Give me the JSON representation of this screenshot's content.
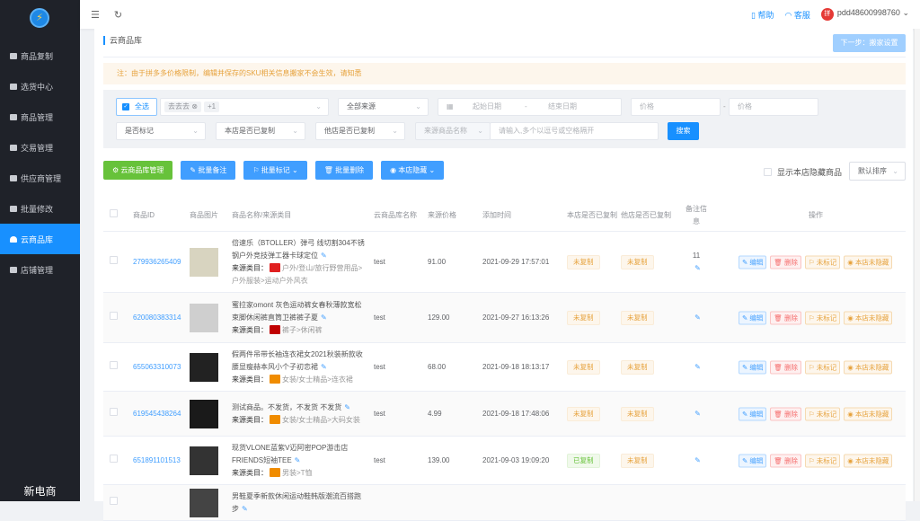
{
  "sidebar": {
    "brand": "新电商",
    "items": [
      {
        "label": "商品复制"
      },
      {
        "label": "选货中心"
      },
      {
        "label": "商品管理"
      },
      {
        "label": "交易管理"
      },
      {
        "label": "供应商管理"
      },
      {
        "label": "批量修改"
      },
      {
        "label": "云商品库",
        "active": true
      },
      {
        "label": "店铺管理"
      }
    ]
  },
  "topbar": {
    "help": "帮助",
    "service": "客服",
    "username": "pdd48600998760"
  },
  "page": {
    "title": "云商品库",
    "next_button": "下一步：搬家设置",
    "notice": "注：由于拼多多价格限制，编辑并保存的SKU相关信息搬家不会生效，请知悉"
  },
  "filters": {
    "select_all": "全选",
    "store_tag": "去去去",
    "more_count": "+1",
    "source": "全部来源",
    "start_date": "起始日期",
    "date_sep": "-",
    "end_date": "结束日期",
    "price_min": "价格",
    "price_sep": "-",
    "price_max": "价格",
    "marked": "是否标记",
    "own_copied": "本店是否已复制",
    "other_copied": "他店是否已复制",
    "name_field": "来源商品名称",
    "keyword_placeholder": "请输入,多个以逗号或空格隔开",
    "search": "搜索"
  },
  "actions": {
    "manage": "云商品库管理",
    "batch_note": "批量备注",
    "batch_mark": "批量标记",
    "batch_delete": "批量删除",
    "hide": "本店隐藏",
    "show_hidden": "显示本店隐藏商品",
    "sort": "默认排序"
  },
  "table": {
    "headers": {
      "id": "商品ID",
      "image": "商品图片",
      "name": "商品名称/来源类目",
      "cloud": "云商品库名称",
      "price": "来源价格",
      "time": "添加时间",
      "own": "本店是否已复制",
      "other": "他店是否已复制",
      "note": "备注信息",
      "ops": "操作"
    },
    "source_label": "来源类目：",
    "op_labels": {
      "edit": "编辑",
      "delete": "删除",
      "mark": "未标记",
      "hide": "本店未隐藏"
    },
    "rows": [
      {
        "id": "279936265409",
        "name": "倍速乐（BTOLLER）弹弓 线切割304不锈钢户外竞技弹工器卡球定位",
        "source": "户外/登山/旅行野营用品>户外服装>运动户外风衣",
        "cloud": "test",
        "price": "91.00",
        "time": "2021-09-29 17:57:01",
        "own": "未复制",
        "other": "未复制",
        "note": "11",
        "badge_color": "#e02020",
        "img_color": "#d8d4c0"
      },
      {
        "id": "620080383314",
        "name": "蜜拉家omont 灰色运动裤女春秋薄款宽松束脚休闲裤直筒卫裤裤子夏",
        "source": "裤子>休闲裤",
        "cloud": "test",
        "price": "129.00",
        "time": "2021-09-27 16:13:26",
        "own": "未复制",
        "other": "未复制",
        "note": "",
        "badge_color": "#c00000",
        "img_color": "#cfcfcf"
      },
      {
        "id": "655063310073",
        "name": "假两件吊带长袖连衣裙女2021秋装新款收腰显瘦赫本风小个子初恋裙",
        "source": "女装/女士精品>连衣裙",
        "cloud": "test",
        "price": "68.00",
        "time": "2021-09-18 18:13:17",
        "own": "未复制",
        "other": "未复制",
        "note": "",
        "badge_color": "#f08c00",
        "img_color": "#222"
      },
      {
        "id": "619545438264",
        "name": "测试商品。不发货，不发货 不发货",
        "source": "女装/女士精品>大码女装",
        "cloud": "test",
        "price": "4.99",
        "time": "2021-09-18 17:48:06",
        "own": "未复制",
        "other": "未复制",
        "note": "",
        "badge_color": "#f08c00",
        "img_color": "#1a1a1a"
      },
      {
        "id": "651891101513",
        "name": "现货VLONE蓝紫V迈阿密POP游击店FRIENDS短袖TEE",
        "source": "男装>T恤",
        "cloud": "test",
        "price": "139.00",
        "time": "2021-09-03 19:09:20",
        "own": "已复制",
        "other": "未复制",
        "note": "",
        "badge_color": "#f08c00",
        "img_color": "#333"
      },
      {
        "id": "",
        "name": "男鞋夏季新款休闲运动鞋韩版潮流百搭跑步",
        "source": "",
        "cloud": "",
        "price": "",
        "time": "",
        "own": "",
        "other": "",
        "note": "",
        "badge_color": "#f08c00",
        "img_color": "#444"
      }
    ]
  }
}
